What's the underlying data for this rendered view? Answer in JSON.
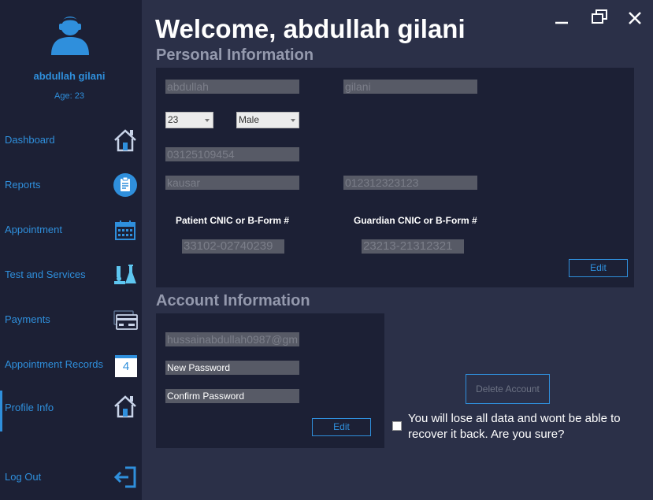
{
  "colors": {
    "accent": "#2f8fdc",
    "sidebar_bg": "#1c2035",
    "main_bg": "#2b3048",
    "field_bg": "#575a66"
  },
  "user": {
    "name": "abdullah gilani",
    "age": "Age: 23"
  },
  "nav": {
    "items": [
      {
        "label": "Dashboard",
        "icon": "home-icon"
      },
      {
        "label": "Reports",
        "icon": "clipboard-icon"
      },
      {
        "label": "Appointment",
        "icon": "calendar-icon"
      },
      {
        "label": "Test and Services",
        "icon": "lab-icon"
      },
      {
        "label": "Payments",
        "icon": "credit-card-icon"
      },
      {
        "label": "Appointment Records",
        "icon": "calendar-number-icon",
        "badge": "4"
      },
      {
        "label": "Profile Info",
        "icon": "home-icon"
      },
      {
        "label": "Log Out",
        "icon": "logout-icon"
      }
    ]
  },
  "window": {
    "minimize": "minimize-icon",
    "restore": "restore-icon",
    "close": "close-icon"
  },
  "header": {
    "welcome": "Welcome, abdullah gilani"
  },
  "personal": {
    "title": "Personal Information",
    "first_name": "abdullah",
    "last_name": "gilani",
    "age_value": "23",
    "gender_value": "Male",
    "phone": "03125109454",
    "guardian_name": "kausar",
    "guardian_phone": "012312323123",
    "patient_cnic_label": "Patient CNIC or B-Form #",
    "guardian_cnic_label": "Guardian CNIC or B-Form #",
    "patient_cnic": "33102-02740239",
    "guardian_cnic": "23213-21312321",
    "edit_label": "Edit"
  },
  "account": {
    "title": "Account Information",
    "email": "hussainabdullah0987@gm",
    "new_password_placeholder": "New Password",
    "confirm_password_placeholder": "Confirm Password",
    "edit_label": "Edit",
    "delete_label": "Delete Account",
    "warning": "You will lose all data and wont be able to recover it back. Are you sure?"
  }
}
